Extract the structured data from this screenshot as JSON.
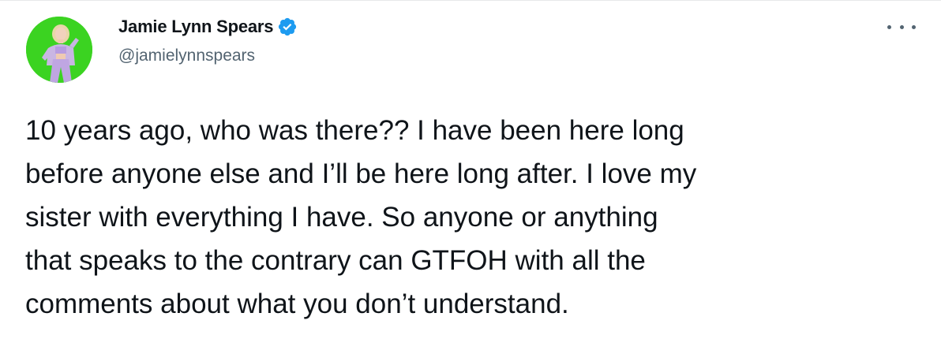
{
  "author": {
    "display_name": "Jamie Lynn Spears",
    "handle": "@jamielynnspears",
    "verified": true,
    "avatar_icon": "profile-photo"
  },
  "tweet": {
    "lines": [
      "10 years ago, who was there?? I have been here long",
      "before anyone else and I’ll be here long after. I love my",
      "sister with everything I have. So anyone or anything",
      "that speaks to the contrary can GTFOH with all the",
      "comments about what you don’t understand."
    ]
  },
  "menu": {
    "icon": "more-options-icon"
  },
  "colors": {
    "text": "#0f1419",
    "secondary": "#536471",
    "verified_badge": "#1d9bf0",
    "avatar_background": "#3bd321"
  }
}
